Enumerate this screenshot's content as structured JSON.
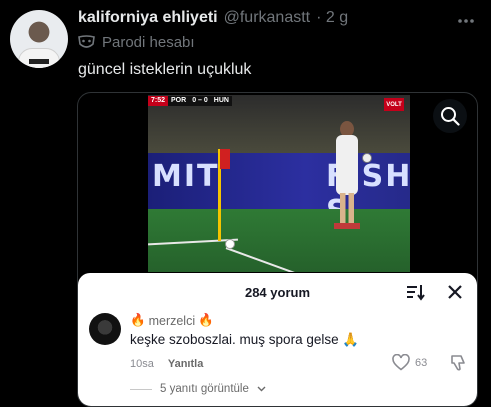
{
  "tweet": {
    "display_name": "kaliforniya ehliyeti",
    "handle": "@furkanastt",
    "time": "· 2 g",
    "badge_label": "Parodi hesabı",
    "text": "güncel isteklerin uçukluk",
    "more_icon": "ellipsis-icon"
  },
  "video": {
    "scorebug": {
      "time": "7:52",
      "home": "POR",
      "score": "0 – 0",
      "away": "HUN"
    },
    "channel": "VOLT",
    "board_left": "MIT",
    "board_right": "FISH S",
    "search_icon": "search-icon"
  },
  "comments": {
    "title": "284 yorum",
    "comment": {
      "username": "merzelci",
      "emoji": "🔥",
      "text": "keşke szoboszlai. muş spora gelse",
      "text_emoji": "🙏",
      "age": "10sa",
      "reply_label": "Yanıtla",
      "likes": "63"
    },
    "view_replies": "5 yanıtı görüntüle"
  },
  "colors": {
    "background": "#000000",
    "muted": "#71767b",
    "text": "#e7e9ea",
    "sheet": "#ffffff"
  }
}
